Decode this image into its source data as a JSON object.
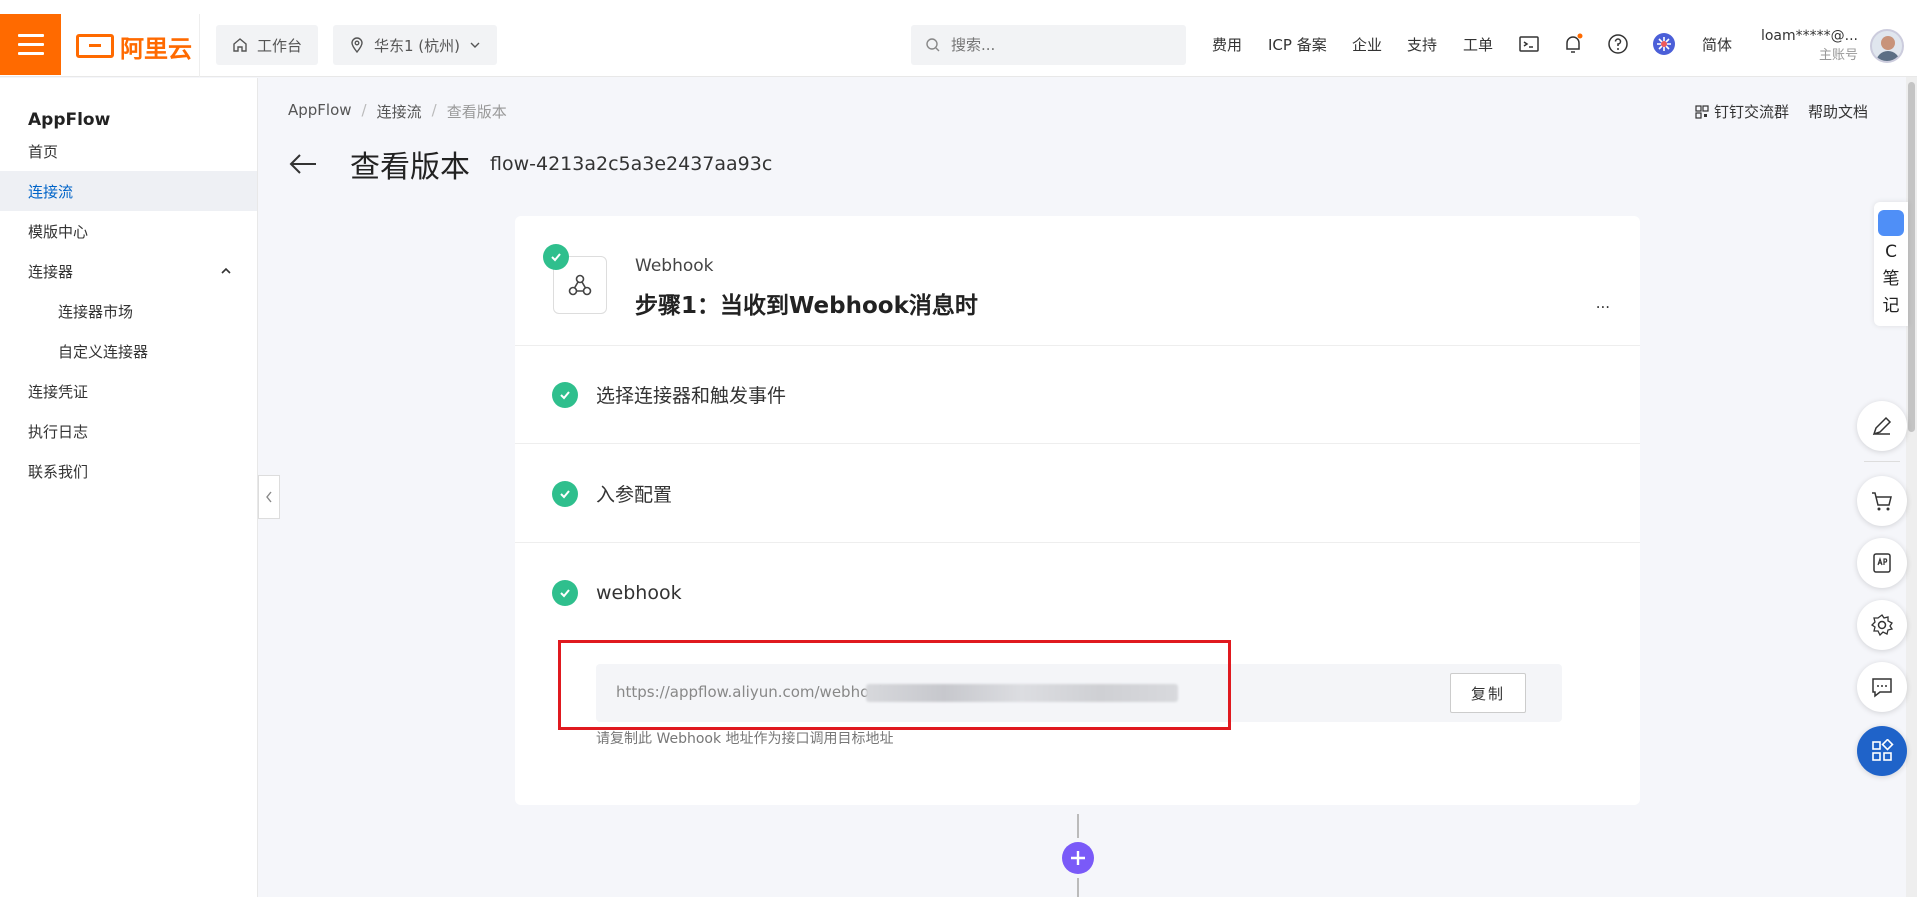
{
  "topbar": {
    "brand": "阿里云",
    "workbench": "工作台",
    "region": "华东1 (杭州)",
    "search_placeholder": "搜索...",
    "links": [
      "费用",
      "ICP 备案",
      "企业",
      "支持",
      "工单"
    ],
    "lang": "简体",
    "user_name": "loam*****@...",
    "user_role": "主账号"
  },
  "sidebar": {
    "title": "AppFlow",
    "items": [
      {
        "label": "首页"
      },
      {
        "label": "连接流",
        "active": true
      },
      {
        "label": "模版中心"
      },
      {
        "label": "连接器",
        "expanded": true
      },
      {
        "label": "连接器市场"
      },
      {
        "label": "自定义连接器"
      },
      {
        "label": "连接凭证"
      },
      {
        "label": "执行日志"
      },
      {
        "label": "联系我们"
      }
    ]
  },
  "breadcrumb": [
    "AppFlow",
    "连接流",
    "查看版本"
  ],
  "page": {
    "title": "查看版本",
    "flow_id": "flow-4213a2c5a3e2437aa93c",
    "help_links": [
      "钉钉交流群",
      "帮助文档"
    ]
  },
  "step": {
    "tag": "Webhook",
    "title": "步骤1：当收到Webhook消息时",
    "more": "...",
    "rows": [
      "选择连接器和触发事件",
      "入参配置",
      "webhook"
    ],
    "url": "https://appflow.aliyun.com/webhook/",
    "copy_label": "复制",
    "hint": "请复制此 Webhook 地址作为接口调用目标地址"
  },
  "note_tab": {
    "label_c": "C",
    "label_1": "笔",
    "label_2": "记"
  },
  "colors": {
    "accent": "#ff6a00",
    "primary": "#0064c8",
    "success": "#2fbf8d",
    "add": "#7a5af8",
    "highlight": "#e0191f"
  }
}
